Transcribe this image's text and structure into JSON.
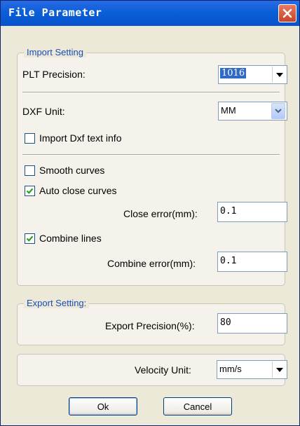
{
  "window": {
    "title": "File Parameter"
  },
  "import_setting": {
    "legend": "Import Setting",
    "plt_precision_label": "PLT Precision:",
    "plt_precision_value": "1016",
    "dxf_unit_label": "DXF Unit:",
    "dxf_unit_value": "MM",
    "import_dxf_text_label": "Import Dxf text info",
    "import_dxf_text_checked": false,
    "smooth_curves_label": "Smooth curves",
    "smooth_curves_checked": false,
    "auto_close_label": "Auto close curves",
    "auto_close_checked": true,
    "close_error_label": "Close error(mm):",
    "close_error_value": "0.1",
    "combine_lines_label": "Combine lines",
    "combine_lines_checked": true,
    "combine_error_label": "Combine error(mm):",
    "combine_error_value": "0.1"
  },
  "export_setting": {
    "legend": "Export Setting:",
    "export_precision_label": "Export Precision(%):",
    "export_precision_value": "80"
  },
  "velocity": {
    "label": "Velocity Unit:",
    "value": "mm/s"
  },
  "buttons": {
    "ok": "Ok",
    "cancel": "Cancel"
  },
  "icons": {
    "close": "close-icon",
    "dropdown": "triangle-down-icon",
    "checkmark": "checkmark-icon"
  },
  "colors": {
    "titlebar": "#0A5FD8",
    "close_button": "#D4553A",
    "legend_text": "#1A4DB5",
    "selection": "#316AC5",
    "check": "#21A121"
  }
}
